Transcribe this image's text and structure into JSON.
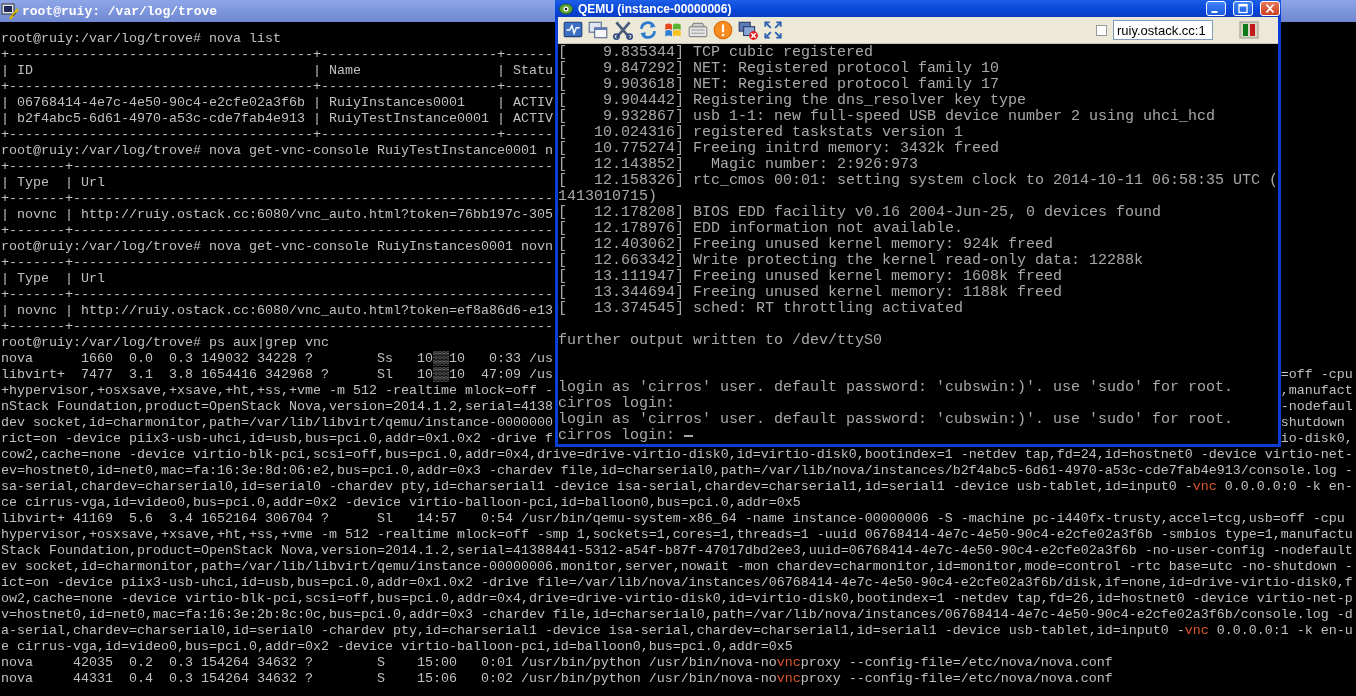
{
  "terminal": {
    "title": "root@ruiy: /var/log/trove",
    "lines": [
      {
        "parts": [
          {
            "text": "root@ruiy:/var/log/trove# nova list",
            "kind": "plain"
          }
        ]
      },
      {
        "parts": [
          {
            "text": "+--------------------------------------+----------------------+------",
            "kind": "plain"
          }
        ]
      },
      {
        "parts": [
          {
            "text": "| ID                                   | Name                 | Statu",
            "kind": "plain"
          }
        ]
      },
      {
        "parts": [
          {
            "text": "+--------------------------------------+----------------------+------",
            "kind": "plain"
          }
        ]
      },
      {
        "parts": [
          {
            "text": "| 06768414-4e7c-4e50-90c4-e2cfe02a3f6b | RuiyInstances0001    | ACTIV",
            "kind": "plain"
          }
        ]
      },
      {
        "parts": [
          {
            "text": "| b2f4abc5-6d61-4970-a53c-cde7fab4e913 | RuiyTestInstance0001 | ACTIV",
            "kind": "plain"
          }
        ]
      },
      {
        "parts": [
          {
            "text": "+--------------------------------------+----------------------+------",
            "kind": "plain"
          }
        ]
      },
      {
        "parts": [
          {
            "text": "root@ruiy:/var/log/trove# nova get-vnc-console RuiyTestInstance0001 n",
            "kind": "plain"
          }
        ]
      },
      {
        "parts": [
          {
            "text": "+-------+------------------------------------------------------------",
            "kind": "plain"
          }
        ]
      },
      {
        "parts": [
          {
            "text": "| Type  | Url",
            "kind": "plain"
          }
        ]
      },
      {
        "parts": [
          {
            "text": "+-------+------------------------------------------------------------",
            "kind": "plain"
          }
        ]
      },
      {
        "parts": [
          {
            "text": "| novnc | http://ruiy.ostack.cc:6080/vnc_auto.html?token=76bb197c-305",
            "kind": "plain"
          }
        ]
      },
      {
        "parts": [
          {
            "text": "+-------+------------------------------------------------------------",
            "kind": "plain"
          }
        ]
      },
      {
        "parts": [
          {
            "text": "root@ruiy:/var/log/trove# nova get-vnc-console RuiyInstances0001 novn",
            "kind": "plain"
          }
        ]
      },
      {
        "parts": [
          {
            "text": "+-------+------------------------------------------------------------",
            "kind": "plain"
          }
        ]
      },
      {
        "parts": [
          {
            "text": "| Type  | Url",
            "kind": "plain"
          }
        ]
      },
      {
        "parts": [
          {
            "text": "+-------+------------------------------------------------------------",
            "kind": "plain"
          }
        ]
      },
      {
        "parts": [
          {
            "text": "| novnc | http://ruiy.ostack.cc:6080/vnc_auto.html?token=ef8a86d6-e13",
            "kind": "plain"
          }
        ]
      },
      {
        "parts": [
          {
            "text": "+-------+------------------------------------------------------------",
            "kind": "plain"
          }
        ]
      },
      {
        "parts": [
          {
            "text": "root@ruiy:/var/log/trove# ps aux|grep vnc",
            "kind": "plain"
          }
        ]
      },
      {
        "parts": [
          {
            "text": "nova      1660  0.0  0.3 149032 34228 ?        Ss   10▒▒10   0:33 /us",
            "kind": "plain"
          }
        ]
      },
      {
        "parts": [
          {
            "text": "libvirt+  7477  3.1  3.8 1654416 342968 ?      Sl   10▒▒10  47:09 /us",
            "kind": "plain"
          }
        ],
        "after_window": [
          {
            "text": "=off -cpu",
            "kind": "plain"
          }
        ]
      },
      {
        "parts": [
          {
            "text": "+hypervisor,+osxsave,+xsave,+ht,+ss,+vme -m 512 -realtime mlock=off -",
            "kind": "plain"
          }
        ],
        "after_window": [
          {
            "text": ",manufact",
            "kind": "plain"
          }
        ]
      },
      {
        "parts": [
          {
            "text": "nStack Foundation,product=OpenStack Nova,version=2014.1.2,serial=4138",
            "kind": "plain"
          }
        ],
        "after_window": [
          {
            "text": "-nodefaul",
            "kind": "plain"
          }
        ]
      },
      {
        "parts": [
          {
            "text": "dev socket,id=charmonitor,path=/var/lib/libvirt/qemu/instance-0000000",
            "kind": "plain"
          }
        ],
        "after_window": [
          {
            "text": "shutdown",
            "kind": "plain"
          }
        ]
      },
      {
        "parts": [
          {
            "text": "rict=on -device piix3-usb-uhci,id=usb,bus=pci.0,addr=0x1.0x2 -drive f",
            "kind": "plain"
          }
        ],
        "after_window": [
          {
            "text": "io-disk0,",
            "kind": "plain"
          }
        ]
      },
      {
        "parts": [
          {
            "text": "cow2,cache=none -device virtio-blk-pci,scsi=off,bus=pci.0,addr=0x4,drive=drive-virtio-disk0,id=virtio-disk0,bootindex=1 -netdev tap,fd=24,id=hostnet0 -device virtio-net-",
            "kind": "plain"
          }
        ]
      },
      {
        "parts": [
          {
            "text": "ev=hostnet0,id=net0,mac=fa:16:3e:8d:06:e2,bus=pci.0,addr=0x3 -chardev file,id=charserial0,path=/var/lib/nova/instances/b2f4abc5-6d61-4970-a53c-cde7fab4e913/console.log -",
            "kind": "plain"
          }
        ]
      },
      {
        "parts": [
          {
            "text": "sa-serial,chardev=charserial0,id=serial0 -chardev pty,id=charserial1 -device isa-serial,chardev=charserial1,id=serial1 -device usb-tablet,id=input0 -",
            "kind": "plain"
          },
          {
            "text": "vnc",
            "kind": "highlight"
          },
          {
            "text": " 0.0.0.0:0 -k en-",
            "kind": "plain"
          }
        ]
      },
      {
        "parts": [
          {
            "text": "ce cirrus-vga,id=video0,bus=pci.0,addr=0x2 -device virtio-balloon-pci,id=balloon0,bus=pci.0,addr=0x5",
            "kind": "plain"
          }
        ]
      },
      {
        "parts": [
          {
            "text": "libvirt+ 41169  5.6  3.4 1652164 306704 ?      Sl   14:57   0:54 /usr/bin/qemu-system-x86_64 -name instance-00000006 -S -machine pc-i440fx-trusty,accel=tcg,usb=off -cpu",
            "kind": "plain"
          }
        ]
      },
      {
        "parts": [
          {
            "text": "hypervisor,+osxsave,+xsave,+ht,+ss,+vme -m 512 -realtime mlock=off -smp 1,sockets=1,cores=1,threads=1 -uuid 06768414-4e7c-4e50-90c4-e2cfe02a3f6b -smbios type=1,manufactu",
            "kind": "plain"
          }
        ]
      },
      {
        "parts": [
          {
            "text": "Stack Foundation,product=OpenStack Nova,version=2014.1.2,serial=41388441-5312-a54f-b87f-47017dbd2ee3,uuid=06768414-4e7c-4e50-90c4-e2cfe02a3f6b -no-user-config -nodefault",
            "kind": "plain"
          }
        ]
      },
      {
        "parts": [
          {
            "text": "ev socket,id=charmonitor,path=/var/lib/libvirt/qemu/instance-00000006.monitor,server,nowait -mon chardev=charmonitor,id=monitor,mode=control -rtc base=utc -no-shutdown -",
            "kind": "plain"
          }
        ]
      },
      {
        "parts": [
          {
            "text": "ict=on -device piix3-usb-uhci,id=usb,bus=pci.0,addr=0x1.0x2 -drive file=/var/lib/nova/instances/06768414-4e7c-4e50-90c4-e2cfe02a3f6b/disk,if=none,id=drive-virtio-disk0,f",
            "kind": "plain"
          }
        ]
      },
      {
        "parts": [
          {
            "text": "ow2,cache=none -device virtio-blk-pci,scsi=off,bus=pci.0,addr=0x4,drive=drive-virtio-disk0,id=virtio-disk0,bootindex=1 -netdev tap,fd=26,id=hostnet0 -device virtio-net-p",
            "kind": "plain"
          }
        ]
      },
      {
        "parts": [
          {
            "text": "v=hostnet0,id=net0,mac=fa:16:3e:2b:8c:0c,bus=pci.0,addr=0x3 -chardev file,id=charserial0,path=/var/lib/nova/instances/06768414-4e7c-4e50-90c4-e2cfe02a3f6b/console.log -d",
            "kind": "plain"
          }
        ]
      },
      {
        "parts": [
          {
            "text": "a-serial,chardev=charserial0,id=serial0 -chardev pty,id=charserial1 -device isa-serial,chardev=charserial1,id=serial1 -device usb-tablet,id=input0 -",
            "kind": "plain"
          },
          {
            "text": "vnc",
            "kind": "highlight"
          },
          {
            "text": " 0.0.0.0:1 -k en-u",
            "kind": "plain"
          }
        ]
      },
      {
        "parts": [
          {
            "text": "e cirrus-vga,id=video0,bus=pci.0,addr=0x2 -device virtio-balloon-pci,id=balloon0,bus=pci.0,addr=0x5",
            "kind": "plain"
          }
        ]
      },
      {
        "parts": [
          {
            "text": "nova     42035  0.2  0.3 154264 34632 ?        S    15:00   0:01 /usr/bin/python /usr/bin/nova-no",
            "kind": "plain"
          },
          {
            "text": "vnc",
            "kind": "highlight"
          },
          {
            "text": "proxy --config-file=/etc/nova/nova.conf",
            "kind": "plain"
          }
        ]
      },
      {
        "parts": [
          {
            "text": "nova     44331  0.4  0.3 154264 34632 ?        S    15:06   0:02 /usr/bin/python /usr/bin/nova-no",
            "kind": "plain"
          },
          {
            "text": "vnc",
            "kind": "highlight"
          },
          {
            "text": "proxy --config-file=/etc/nova/nova.conf",
            "kind": "plain"
          }
        ]
      }
    ]
  },
  "qemu": {
    "title": "QEMU (instance-00000006)",
    "toolbar": {
      "checkbox": {
        "checked": false
      },
      "address": "ruiy.ostack.cc:1"
    },
    "console": {
      "cursor": true,
      "blocks": [
        {
          "lines": [
            "[    9.835344] TCP cubic registered",
            "[    9.847292] NET: Registered protocol family 10",
            "[    9.903618] NET: Registered protocol family 17",
            "[    9.904442] Registering the dns_resolver key type",
            "[    9.932867] usb 1-1: new full-speed USB device number 2 using uhci_hcd",
            "[   10.024316] registered taskstats version 1",
            "[   10.775274] Freeing initrd memory: 3432k freed",
            "[   12.143852]   Magic number: 2:926:973",
            "[   12.158326] rtc_cmos 00:01: setting system clock to 2014-10-11 06:58:35 UTC (",
            "1413010715)",
            "[   12.178208] BIOS EDD facility v0.16 2004-Jun-25, 0 devices found",
            "[   12.178976] EDD information not available.",
            "[   12.403062] Freeing unused kernel memory: 924k freed",
            "[   12.663342] Write protecting the kernel read-only data: 12288k",
            "[   13.111947] Freeing unused kernel memory: 1608k freed",
            "[   13.344694] Freeing unused kernel memory: 1188k freed",
            "[   13.374545] sched: RT throttling activated"
          ]
        },
        {
          "lines": [
            "further output written to /dev/ttyS0"
          ]
        },
        {
          "lines": [
            "login as 'cirros' user. default password: 'cubswin:)'. use 'sudo' for root.",
            "cirros login:",
            "login as 'cirros' user. default password: 'cubswin:)'. use 'sudo' for root.",
            "cirros login:"
          ]
        }
      ]
    }
  }
}
